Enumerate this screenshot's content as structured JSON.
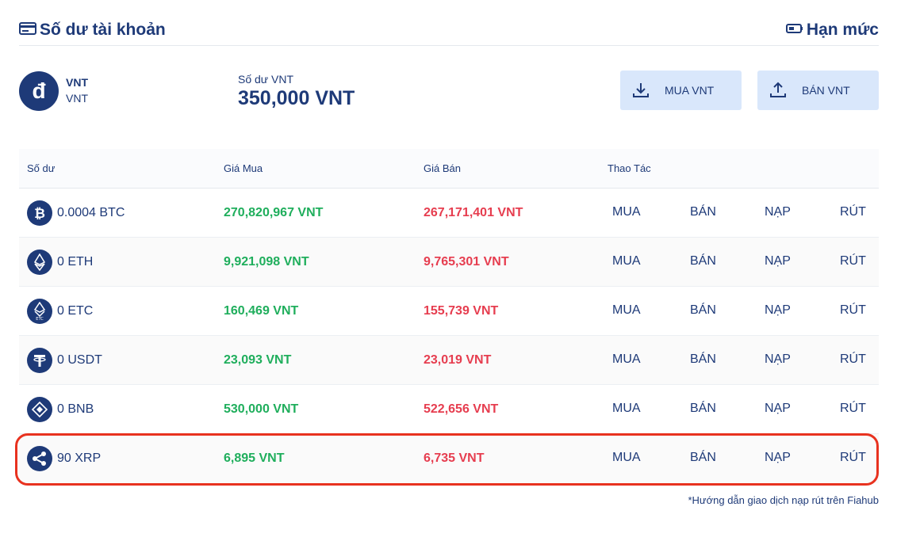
{
  "header": {
    "title": "Số dư tài khoản",
    "limit_label": "Hạn mức"
  },
  "summary": {
    "coin_name": "VNT",
    "coin_code": "VNT",
    "coin_symbol": "đ",
    "balance_label": "Số dư VNT",
    "balance_value": "350,000 VNT",
    "buy_label": "MUA VNT",
    "sell_label": "BÁN VNT"
  },
  "table": {
    "headers": [
      "Số dư",
      "Giá Mua",
      "Giá Bán",
      "Thao Tác"
    ],
    "actions": [
      "MUA",
      "BÁN",
      "NẠP",
      "RÚT"
    ],
    "rows": [
      {
        "icon": "bitcoin-icon",
        "balance": "0.0004 BTC",
        "buy": "270,820,967 VNT",
        "sell": "267,171,401 VNT"
      },
      {
        "icon": "ethereum-icon",
        "balance": "0 ETH",
        "buy": "9,921,098 VNT",
        "sell": "9,765,301 VNT"
      },
      {
        "icon": "ethereum-classic-icon",
        "balance": "0 ETC",
        "buy": "160,469 VNT",
        "sell": "155,739 VNT"
      },
      {
        "icon": "tether-icon",
        "balance": "0 USDT",
        "buy": "23,093 VNT",
        "sell": "23,019 VNT"
      },
      {
        "icon": "binance-coin-icon",
        "balance": "0 BNB",
        "buy": "530,000 VNT",
        "sell": "522,656 VNT"
      },
      {
        "icon": "ripple-icon",
        "balance": "90 XRP",
        "buy": "6,895 VNT",
        "sell": "6,735 VNT"
      }
    ]
  },
  "footnote": "*Hướng dẫn giao dịch nạp rút trên Fiahub",
  "colors": {
    "primary": "#1e3a78",
    "buy_price": "#1fae5c",
    "sell_price": "#e63d4f",
    "button_bg": "#d9e7fb",
    "highlight": "#e8321f"
  }
}
